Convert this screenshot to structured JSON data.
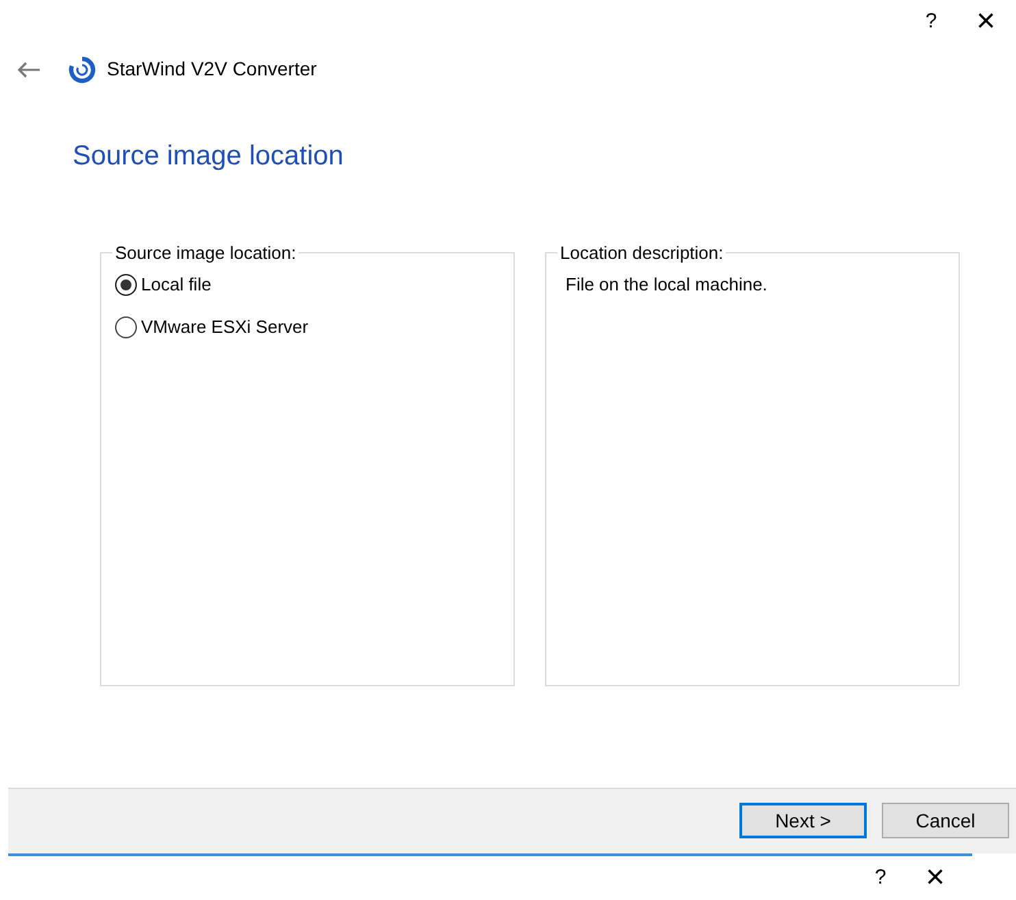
{
  "title_bar": {
    "help": "?",
    "close": "×"
  },
  "header": {
    "app_title": "StarWind V2V Converter"
  },
  "page_title": "Source image location",
  "source_group": {
    "legend": "Source image location:",
    "options": [
      {
        "label": "Local file",
        "selected": true
      },
      {
        "label": "VMware ESXi Server",
        "selected": false
      }
    ]
  },
  "description_group": {
    "legend": "Location description:",
    "text": "File on the local machine."
  },
  "buttons": [
    {
      "label": "Next >",
      "kind": "default"
    },
    {
      "label": "Cancel",
      "kind": "normal"
    }
  ],
  "second_title_bar": {
    "help": "?",
    "close": "×"
  }
}
